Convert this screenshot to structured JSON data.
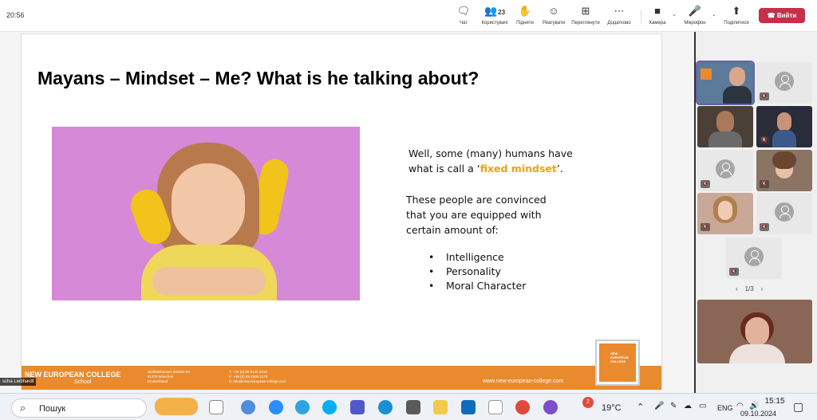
{
  "topbar": {
    "time": "20:56",
    "chat_label": "Чат",
    "people_label": "Користувачі",
    "people_count": "23",
    "raise_label": "Підняти",
    "react_label": "Реагувати",
    "view_label": "Переглянути",
    "apps_label": "Додатково",
    "camera_label": "Камера",
    "mic_label": "Мікрофон",
    "share_label": "Поділитися",
    "leave_label": "Вийти"
  },
  "slide": {
    "title": "Mayans – Mindset – Me? What is he talking about?",
    "text1_a": "Well, some (many) humans have",
    "text1_b": "what is call a ‘",
    "text1_highlight": "fixed mindset",
    "text1_c": "’.",
    "text2_a": "These people are convinced",
    "text2_b": "that you are equipped with",
    "text2_c": "certain amount of:",
    "bullets": [
      "Intelligence",
      "Personality",
      "Moral Character"
    ],
    "footer": {
      "brand": "NEW EUROPEAN COLLEGE",
      "sub": "School",
      "addr1": "Wolfratshauser Strasse 84",
      "addr2": "81379 München",
      "addr3": "Deutschland",
      "tel1": "T: +49 (0) 89 8130 2018",
      "tel2": "F: +49 (0) 89 2305 2173",
      "tel3": "E: info@new-european-college.com",
      "web": "www.new-european-college.com",
      "logo_text": "NEW EUROPEAN COLLEGE"
    }
  },
  "speaker_name": "scha Liebhardt",
  "panel": {
    "pager": "1/3"
  },
  "taskbar": {
    "search_label": "Пошук",
    "weather": "19°C",
    "lang": "ENG",
    "clock_time": "15:15",
    "clock_date": "09.10.2024",
    "notif_count": "2"
  },
  "colors": {
    "accent_orange": "#ea8a2e",
    "highlight": "#f0a30a",
    "leave_red": "#c4314b",
    "slide_photo_bg": "#d689d6"
  }
}
